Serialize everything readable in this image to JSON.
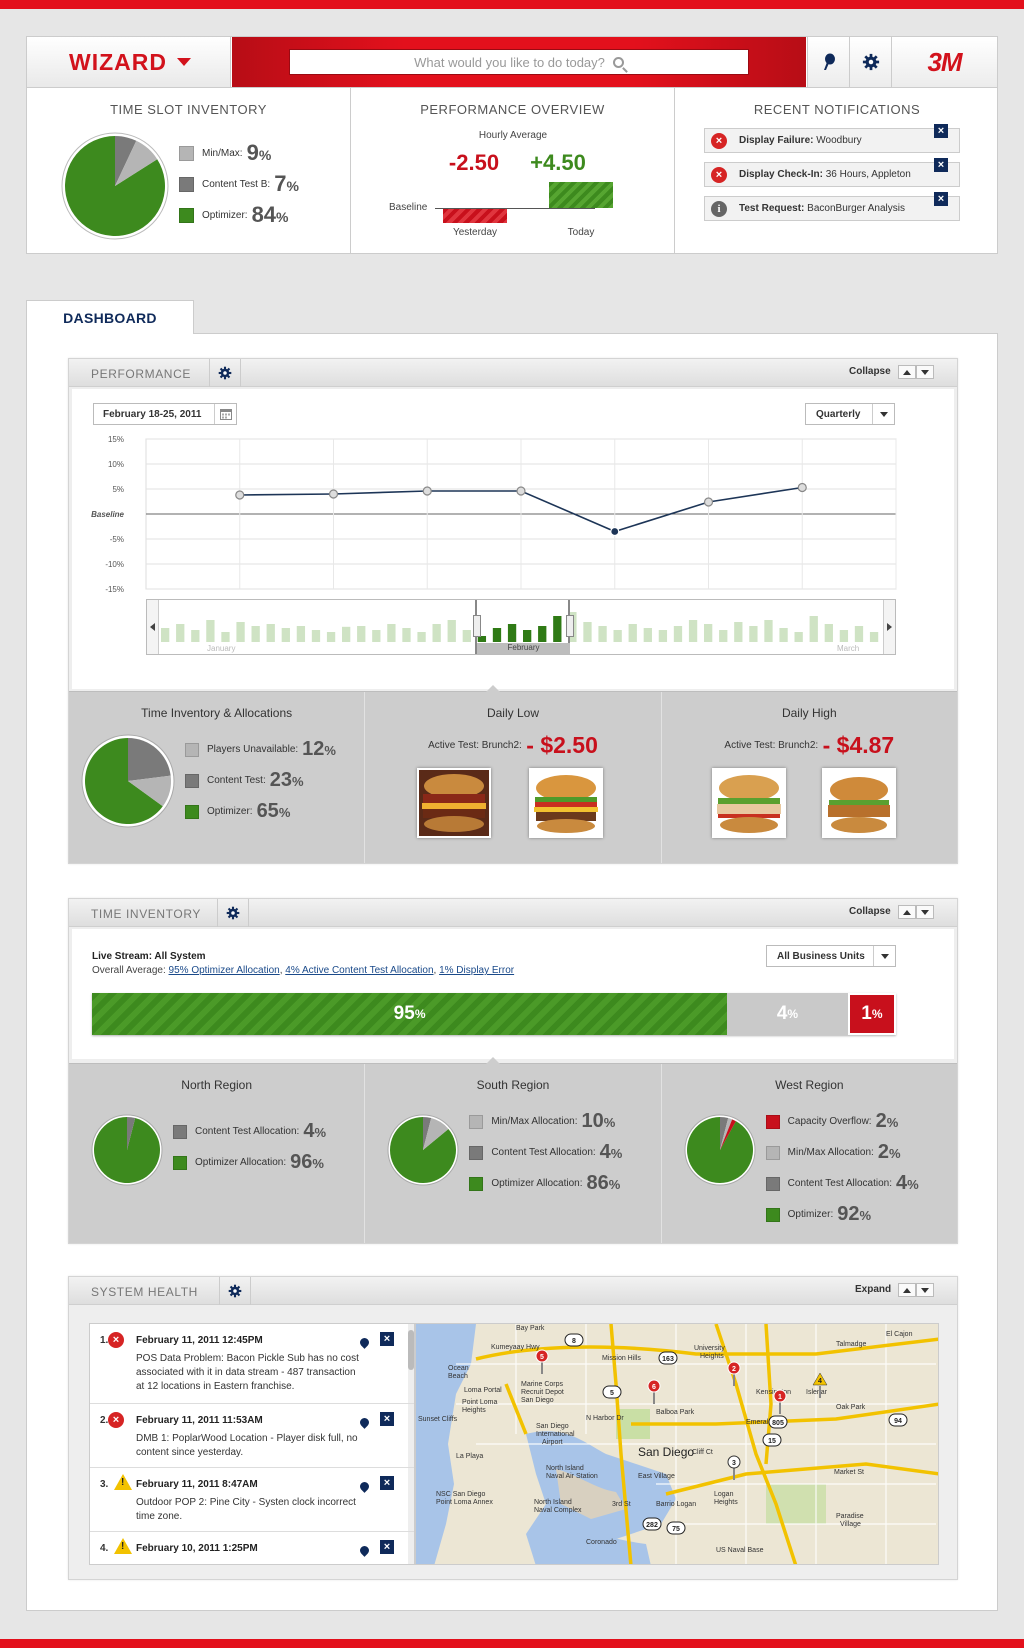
{
  "header": {
    "app_name": "WIZARD",
    "search_placeholder": "What would you like to do today?",
    "brand_logo": "3M",
    "icons": [
      "map-pin-icon",
      "gear-icon"
    ]
  },
  "summary": {
    "time_slot": {
      "title": "TIME SLOT INVENTORY",
      "items": [
        {
          "label": "Min/Max:",
          "value": "9",
          "unit": "%",
          "color": "#b5b5b5"
        },
        {
          "label": "Content Test B:",
          "value": "7",
          "unit": "%",
          "color": "#7a7a7a"
        },
        {
          "label": "Optimizer:",
          "value": "84",
          "unit": "%",
          "color": "#3d8a1e"
        }
      ]
    },
    "performance": {
      "title": "PERFORMANCE OVERVIEW",
      "subtitle": "Hourly Average",
      "yesterday_value": "-2.50",
      "today_value": "+4.50",
      "baseline_label": "Baseline",
      "yesterday_label": "Yesterday",
      "today_label": "Today"
    },
    "notifications": {
      "title": "RECENT NOTIFICATIONS",
      "items": [
        {
          "type": "error",
          "bold": "Display Failure:",
          "text": " Woodbury"
        },
        {
          "type": "error",
          "bold": "Display Check-In:",
          "text": " 36 Hours, Appleton"
        },
        {
          "type": "info",
          "bold": "Test Request:",
          "text": " BaconBurger  Analysis"
        }
      ]
    }
  },
  "dashboard": {
    "tab_label": "DASHBOARD",
    "performance": {
      "title": "PERFORMANCE",
      "collapse_label": "Collapse",
      "date_range": "February 18-25, 2011",
      "period": "Quarterly",
      "y_ticks": [
        "15%",
        "10%",
        "5%",
        "Baseline",
        "-5%",
        "-10%",
        "-15%"
      ],
      "timeline_labels": [
        "January",
        "February",
        "March"
      ],
      "chart_data": {
        "type": "line",
        "y_unit": "%",
        "ylim": [
          -15,
          15
        ],
        "x": [
          1,
          2,
          3,
          4,
          5,
          6,
          7
        ],
        "values": [
          3.8,
          4.0,
          4.6,
          4.6,
          -3.5,
          2.4,
          5.3
        ]
      },
      "timeline_bars": [
        0.35,
        0.45,
        0.3,
        0.55,
        0.25,
        0.5,
        0.4,
        0.45,
        0.35,
        0.4,
        0.3,
        0.25,
        0.38,
        0.4,
        0.3,
        0.45,
        0.35,
        0.25,
        0.45,
        0.55,
        0.3,
        0.15,
        0.35,
        0.45,
        0.3,
        0.4,
        0.65,
        0.75,
        0.5,
        0.4,
        0.3,
        0.45,
        0.35,
        0.3,
        0.4,
        0.55,
        0.45,
        0.3,
        0.5,
        0.4,
        0.55,
        0.35,
        0.25,
        0.65,
        0.45,
        0.3,
        0.4,
        0.25
      ],
      "inventory": {
        "title": "Time Inventory & Allocations",
        "items": [
          {
            "label": "Players Unavailable:",
            "value": "12",
            "unit": "%",
            "color": "#b5b5b5"
          },
          {
            "label": "Content Test:",
            "value": "23",
            "unit": "%",
            "color": "#7a7a7a"
          },
          {
            "label": "Optimizer:",
            "value": "65",
            "unit": "%",
            "color": "#3d8a1e"
          }
        ]
      },
      "daily_low": {
        "title": "Daily Low",
        "test_label": "Active Test: Brunch2:",
        "value": "- $2.50"
      },
      "daily_high": {
        "title": "Daily High",
        "test_label": "Active Test: Brunch2:",
        "value": "- $4.87"
      }
    },
    "time_inventory": {
      "title": "TIME INVENTORY",
      "collapse_label": "Collapse",
      "stream_label": "Live Stream: All System",
      "avg_prefix": "Overall Average: ",
      "links": [
        "95% Optimizer Allocation",
        "4% Active Content Test Allocation",
        "1% Display Error"
      ],
      "business_units": "All Business Units",
      "bar": [
        {
          "value": "95",
          "unit": "%",
          "fraction": 0.79,
          "color": "#3d8a1e"
        },
        {
          "value": "4",
          "unit": "%",
          "fraction": 0.15,
          "color": "#c9c9c9"
        },
        {
          "value": "1",
          "unit": "%",
          "fraction": 0.06,
          "color": "#c8101c"
        }
      ],
      "regions": [
        {
          "title": "North Region",
          "items": [
            {
              "label": "Content Test Allocation:",
              "value": "4",
              "unit": "%",
              "color": "#7a7a7a"
            },
            {
              "label": "Optimizer Allocation:",
              "value": "96",
              "unit": "%",
              "color": "#3d8a1e"
            }
          ]
        },
        {
          "title": "South Region",
          "items": [
            {
              "label": "Min/Max Allocation:",
              "value": "10",
              "unit": "%",
              "color": "#b5b5b5"
            },
            {
              "label": "Content Test Allocation:",
              "value": "4",
              "unit": "%",
              "color": "#7a7a7a"
            },
            {
              "label": "Optimizer Allocation:",
              "value": "86",
              "unit": "%",
              "color": "#3d8a1e"
            }
          ]
        },
        {
          "title": "West Region",
          "items": [
            {
              "label": "Capacity Overflow:",
              "value": "2",
              "unit": "%",
              "color": "#c8101c"
            },
            {
              "label": "Min/Max Allocation:",
              "value": "2",
              "unit": "%",
              "color": "#b5b5b5"
            },
            {
              "label": "Content Test Allocation:",
              "value": "4",
              "unit": "%",
              "color": "#7a7a7a"
            },
            {
              "label": "Optimizer:",
              "value": "92",
              "unit": "%",
              "color": "#3d8a1e"
            }
          ]
        }
      ]
    },
    "system_health": {
      "title": "SYSTEM HEALTH",
      "expand_label": "Expand",
      "events": [
        {
          "num": "1.",
          "type": "error",
          "date": "February 11, 2011 12:45PM",
          "text": "POS Data Problem: Bacon Pickle Sub has no cost associated with it in data stream - 487 transaction at 12 locations in Eastern franchise."
        },
        {
          "num": "2.",
          "type": "error",
          "date": "February 11, 2011 11:53AM",
          "text": "DMB 1: PoplarWood Location - Player disk full, no content since yesterday."
        },
        {
          "num": "3.",
          "type": "warning",
          "date": "February 11, 2011 8:47AM",
          "text": "Outdoor POP 2: Pine City - Systen clock incorrect time zone."
        },
        {
          "num": "4.",
          "type": "warning",
          "date": "February 10, 2011 1:25PM",
          "text": ""
        }
      ],
      "map": {
        "labels": [
          "Bay Park",
          "Kumeyaay Hwy",
          "Mission Hills",
          "University Heights",
          "Talmadge",
          "El Cajon",
          "Ocean Beach",
          "Marine Corps Recruit Depot",
          "San Diego",
          "Balboa Park",
          "Kensington",
          "Islenar",
          "Oak Park",
          "Sunset Cliffs",
          "Loma Portal",
          "Point Loma Heights",
          "San Diego International Airport",
          "N Harbor Dr",
          "La Playa",
          "San Diego",
          "North Island Naval Air Station",
          "East Village",
          "Market St",
          "North Island Naval Complex",
          "NSC San Diego Point Loma Annex",
          "Barrio Logan",
          "Logan Heights",
          "Paradise Village",
          "Coronado",
          "US Naval Base",
          "3rd St",
          "Cliff Ct",
          "Emerald Hills"
        ],
        "markers": [
          "5",
          "6",
          "2",
          "1",
          "4",
          "3"
        ],
        "shields": [
          "8",
          "163",
          "5",
          "15",
          "805",
          "94",
          "282",
          "75"
        ]
      }
    }
  }
}
